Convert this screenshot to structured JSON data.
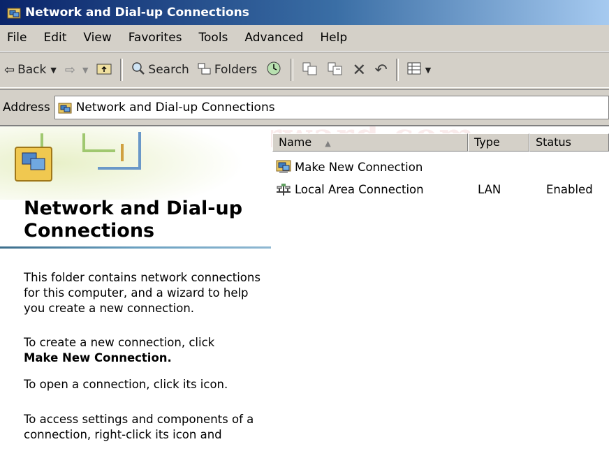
{
  "window": {
    "title": "Network and Dial-up Connections",
    "title_icon": "network-folder-icon"
  },
  "menubar": {
    "items": [
      "File",
      "Edit",
      "View",
      "Favorites",
      "Tools",
      "Advanced",
      "Help"
    ]
  },
  "toolbar": {
    "back_label": "Back",
    "search_label": "Search",
    "folders_label": "Folders"
  },
  "address": {
    "label": "Address",
    "value": "Network and Dial-up Connections"
  },
  "leftpane": {
    "title": "Network and Dial-up Connections",
    "para1": "This folder contains network connections for this computer, and a wizard to help you create a new connection.",
    "para2_prefix": "To create a new connection, click",
    "para2_bold": "Make New Connection.",
    "para3": "To open a connection, click its icon.",
    "para4": "To access settings and components of a connection, right-click its icon and"
  },
  "list": {
    "columns": {
      "name": "Name",
      "type": "Type",
      "status": "Status"
    },
    "rows": [
      {
        "name": "Make New Connection",
        "type": "",
        "status": "",
        "icon": "make-new-connection-icon"
      },
      {
        "name": "Local Area Connection",
        "type": "LAN",
        "status": "Enabled",
        "icon": "lan-connection-icon"
      }
    ]
  },
  "watermark": "portforward.com",
  "colors": {
    "titlebar_start": "#0a246a",
    "titlebar_end": "#a6caf0",
    "window_chrome": "#d4d0c8",
    "rule_accent": "#3c6e8c"
  }
}
